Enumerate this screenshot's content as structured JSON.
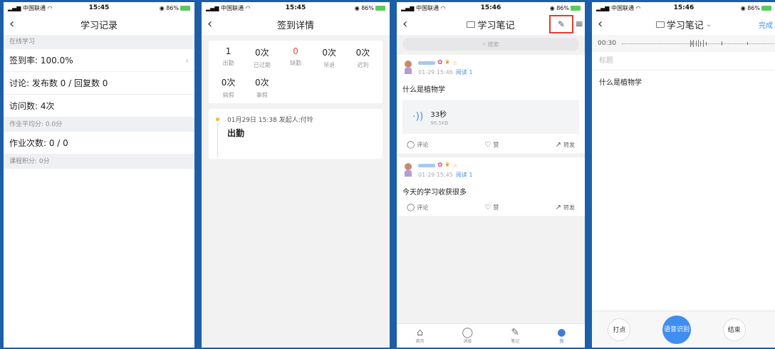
{
  "status": {
    "carrier": "中国联通",
    "battery": "86%",
    "times": [
      "15:45",
      "15:45",
      "15:46",
      "15:46"
    ]
  },
  "p1": {
    "title": "学习记录",
    "sec_online": "在线学习",
    "sign_rate": "签到率:  100.0%",
    "discussion": "讨论: 发布数 0 / 回复数 0",
    "visits": "访问数: 4次",
    "sec_homework_avg": "作业平均分: 0.0分",
    "homework_count": "作业次数:  0 / 0",
    "sec_course_score": "课程积分: 0分"
  },
  "p2": {
    "title": "签到详情",
    "stats": [
      {
        "value": "1",
        "label": "出勤"
      },
      {
        "value": "0次",
        "label": "已过期"
      },
      {
        "value": "0",
        "label": "缺勤",
        "red": true
      },
      {
        "value": "0次",
        "label": "早退"
      },
      {
        "value": "0次",
        "label": "迟到"
      },
      {
        "value": "0次",
        "label": "病假"
      },
      {
        "value": "0次",
        "label": "事假"
      }
    ],
    "record_meta": "01月29日 15:38 发起人:付玲",
    "record_text": "出勤"
  },
  "p3": {
    "title": "学习笔记",
    "search_placeholder": "搜索",
    "post1": {
      "meta": "01-29 15:46",
      "read": "阅读 1",
      "text": "什么是植物学",
      "audio_duration": "33秒",
      "audio_size": "96.5KB"
    },
    "post2": {
      "meta": "01-29 15:45",
      "read": "阅读 1",
      "text": "今天的学习收获很多"
    },
    "actions": {
      "comment": "评论",
      "like": "赞",
      "share": "转发"
    },
    "tabs": [
      "首页",
      "消息",
      "笔记",
      "我"
    ]
  },
  "p4": {
    "title": "学习笔记",
    "done": "完成",
    "rec_time": "00:30",
    "title_placeholder": "标题",
    "content": "什么是植物学",
    "btn_mark": "打点",
    "btn_voice": "语音识别",
    "btn_end": "结束"
  }
}
